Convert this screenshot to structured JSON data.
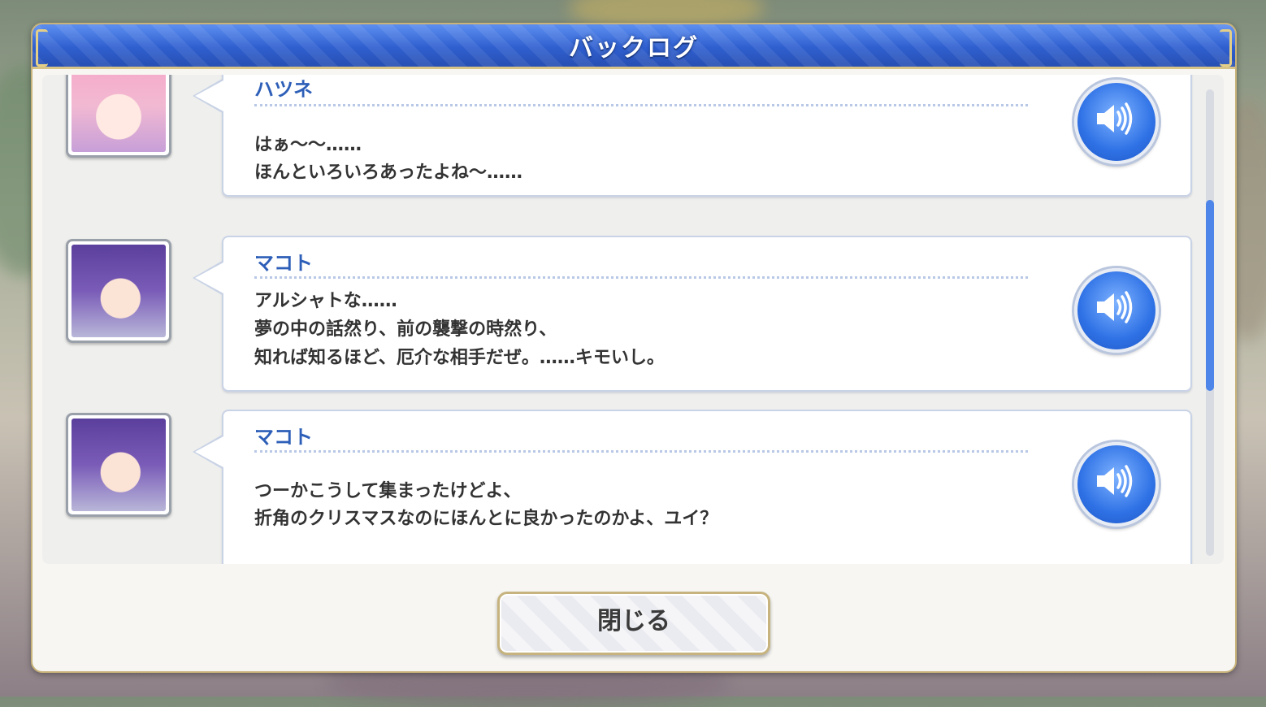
{
  "window": {
    "title": "バックログ"
  },
  "entries": [
    {
      "speaker": "ハツネ",
      "lines": [
        "はぁ～～……",
        "ほんといろいろあったよね～……"
      ]
    },
    {
      "speaker": "マコト",
      "lines": [
        "アルシャトな……",
        "夢の中の話然り、前の襲撃の時然り、",
        "知れば知るほど、厄介な相手だぜ。……キモいし。"
      ]
    },
    {
      "speaker": "マコト",
      "lines": [
        "つーかこうして集まったけどよ、",
        "折角のクリスマスなのにほんとに良かったのかよ、ユイ？"
      ]
    }
  ],
  "icons": {
    "voice": "speaker-icon"
  },
  "colors": {
    "accent": "#2e5fb8",
    "titlebar": "#3a68d6",
    "border_gold": "#c8b37a",
    "voice_button": "#2f72e6"
  },
  "scroll": {
    "position_fraction": 0.4
  },
  "footer": {
    "close_label": "閉じる"
  }
}
